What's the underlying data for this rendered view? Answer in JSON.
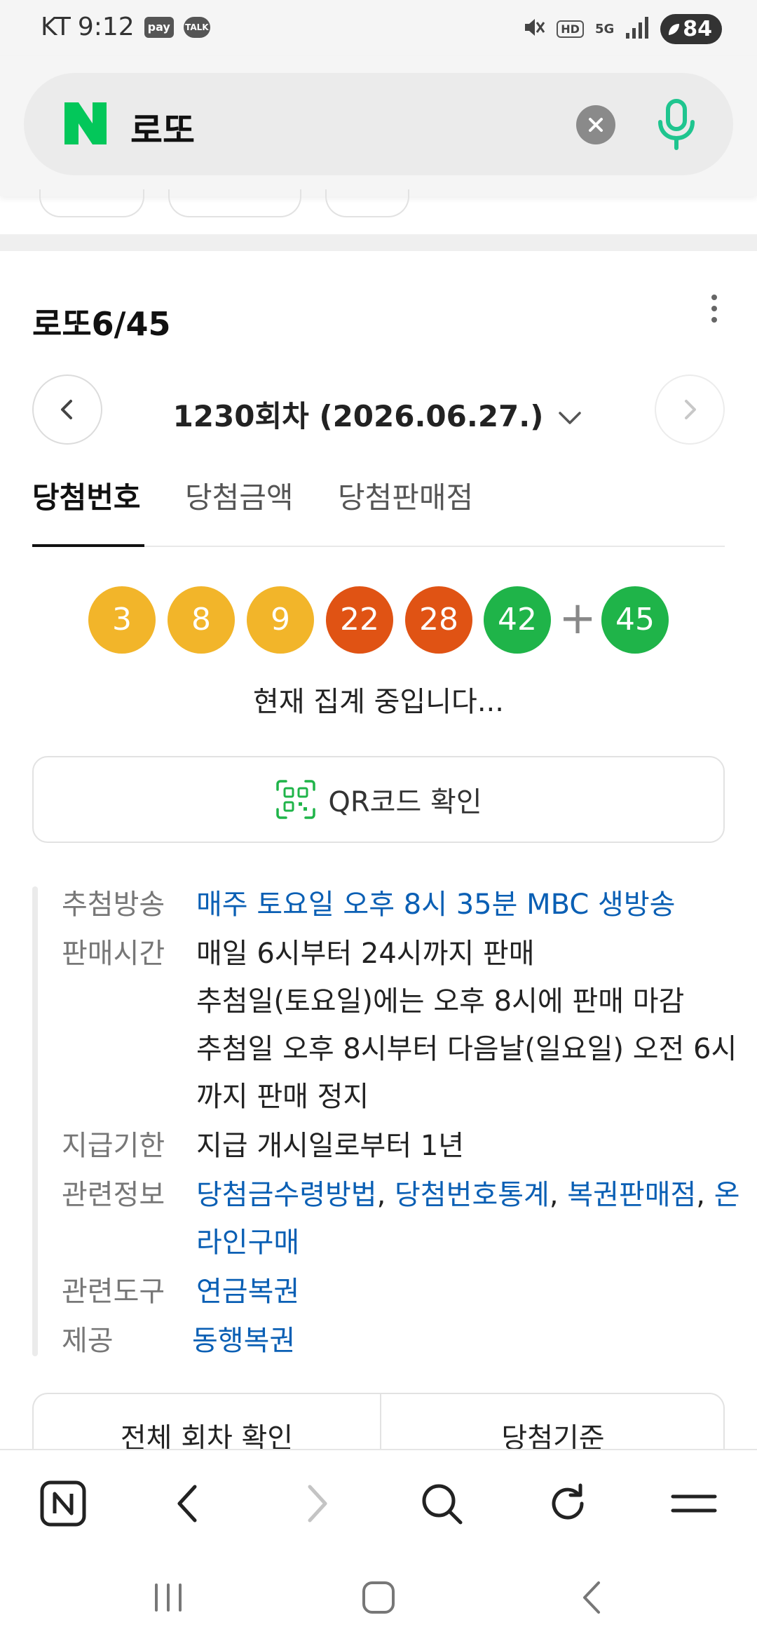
{
  "status_bar": {
    "carrier": "KT",
    "time": "9:12",
    "pay_badge": "pay",
    "talk_badge": "TALK",
    "hd_label": "HD",
    "network_label": "5G",
    "battery": "84"
  },
  "search": {
    "query": "로또"
  },
  "lotto": {
    "title": "로또6/45",
    "round_label": "1230회차 (2026.06.27.)",
    "tabs": [
      {
        "label": "당첨번호"
      },
      {
        "label": "당첨금액"
      },
      {
        "label": "당첨판매점"
      }
    ],
    "numbers": [
      "3",
      "8",
      "9",
      "22",
      "28",
      "42"
    ],
    "bonus": "45",
    "plus": "+",
    "status_message": "현재 집계 중입니다...",
    "qr_label": "QR코드 확인",
    "info": {
      "broadcast_label": "추첨방송",
      "broadcast_value": "매주 토요일 오후 8시 35분 MBC 생방송",
      "sales_label": "판매시간",
      "sales_line1": "매일 6시부터 24시까지 판매",
      "sales_line2": "추첨일(토요일)에는 오후 8시에 판매 마감",
      "sales_line3": "추첨일 오후 8시부터 다음날(일요일) 오전 6시까지 판매 정지",
      "payment_label": "지급기한",
      "payment_value": "지급 개시일로부터 1년",
      "related_label": "관련정보",
      "related_links": [
        "당첨금수령방법",
        "당첨번호통계",
        "복권판매점",
        "온라인구매"
      ],
      "tools_label": "관련도구",
      "tools_value": "연금복권",
      "provider_label": "제공",
      "provider_value": "동행복권"
    },
    "bottom_tabs": [
      "전체 회차 확인",
      "당첨기준"
    ]
  },
  "colors": {
    "naver_green": "#03c75a",
    "ball_yellow": "#f2b52a",
    "ball_red": "#e05314",
    "ball_green": "#1fb449",
    "link_blue": "#0a5fb4"
  }
}
